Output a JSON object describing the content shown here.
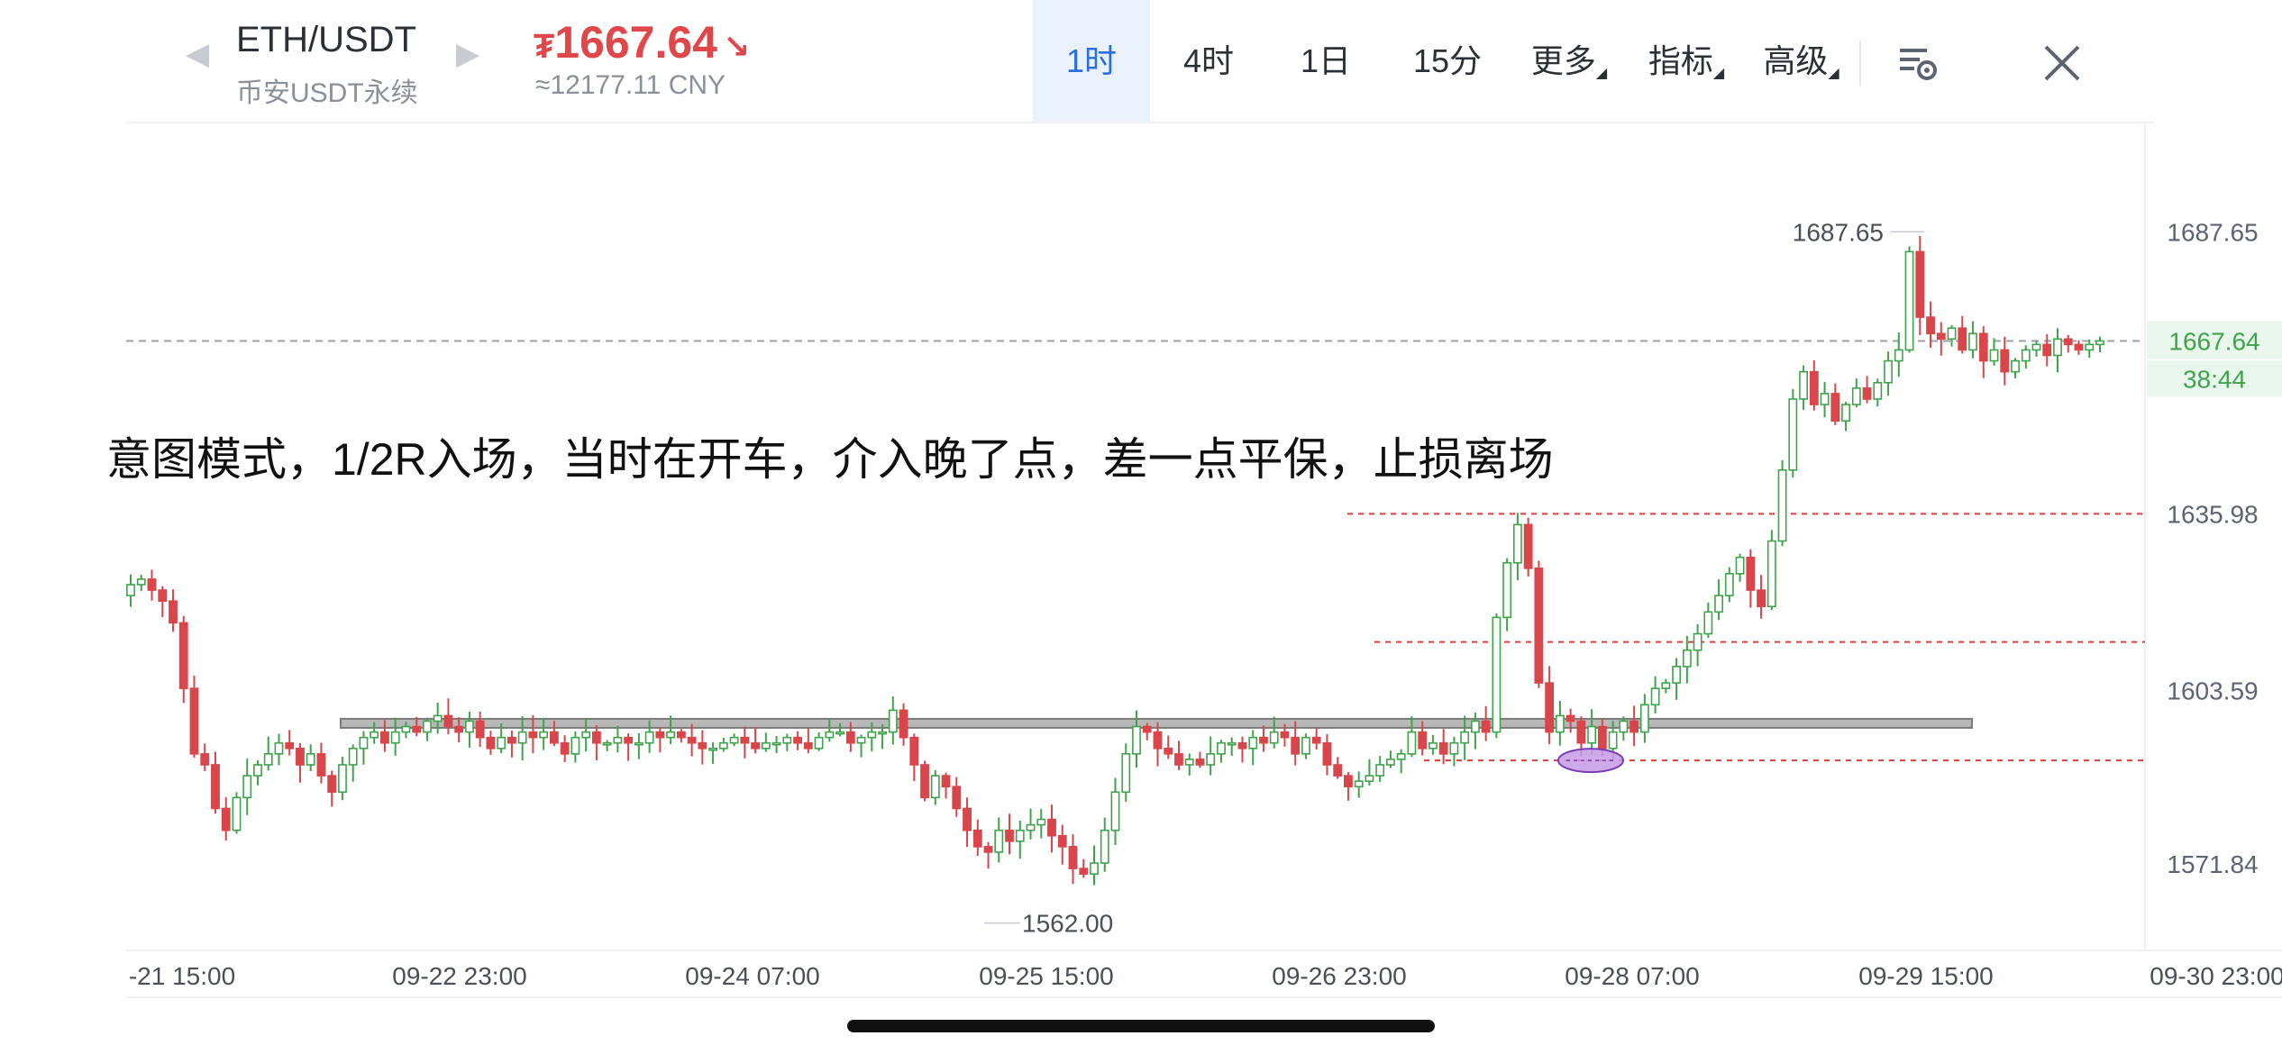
{
  "header": {
    "pair": "ETH/USDT",
    "market": "币安USDT永续",
    "price_currency": "₮",
    "price": "1667.64",
    "price_direction_glyph": "↘",
    "price_cny": "≈12177.11 CNY",
    "tabs": [
      {
        "label": "1时",
        "active": true
      },
      {
        "label": "4时",
        "active": false
      },
      {
        "label": "1日",
        "active": false
      },
      {
        "label": "15分",
        "active": false
      },
      {
        "label": "更多",
        "active": false,
        "dropdown": true
      },
      {
        "label": "指标",
        "active": false,
        "dropdown": true
      },
      {
        "label": "高级",
        "active": false,
        "dropdown": true
      }
    ],
    "icons": [
      "prev-arrow-icon",
      "next-arrow-icon",
      "chart-settings-icon",
      "close-icon"
    ]
  },
  "annotation": "意图模式，1/2R入场，当时在开车，介入晚了点，差一点平保，止损离场",
  "chart_data": {
    "type": "candlestick",
    "colors": {
      "up": "#3fa34d",
      "down": "#d8464b",
      "guide": "#e03a3a",
      "zone": "#a6a6a6",
      "marker": "#c79be8"
    },
    "y_ticks": [
      1687.65,
      1667.64,
      1635.98,
      1603.59,
      1571.84
    ],
    "y_tick_labels": [
      "1687.65",
      "1667.64",
      "1635.98",
      "1603.59",
      "1571.84"
    ],
    "ylim": [
      1556,
      1707
    ],
    "x_tick_labels": [
      "-21 15:00",
      "09-22 23:00",
      "09-24 07:00",
      "09-25 15:00",
      "09-26 23:00",
      "09-28 07:00",
      "09-29 15:00",
      "09-30 23:00"
    ],
    "current_price": {
      "value": 1667.64,
      "label": "1667.64",
      "countdown": "38:44"
    },
    "high_label": {
      "value": 1687.65,
      "label": "1687.65"
    },
    "low_label": {
      "value": 1562.0,
      "label": "1562.00"
    },
    "horizontal_lines": [
      {
        "name": "resistance",
        "value": 1635.98,
        "style": "dashed-red"
      },
      {
        "name": "mid-level",
        "value": 1612.5,
        "style": "dashed-red"
      },
      {
        "name": "stop-level",
        "value": 1590.8,
        "style": "dashed-red"
      }
    ],
    "range_zone": {
      "value": 1597.6
    },
    "marker": {
      "value": 1590.8
    },
    "candles_hourly_close": [
      1623,
      1624,
      1622,
      1620,
      1616,
      1604,
      1592,
      1590,
      1582,
      1578,
      1584,
      1588,
      1590,
      1592,
      1594,
      1593,
      1590,
      1592,
      1588,
      1585,
      1590,
      1593,
      1595,
      1596,
      1594,
      1596,
      1597,
      1596,
      1598,
      1599,
      1597,
      1596,
      1598,
      1595,
      1593,
      1595,
      1594,
      1596,
      1595,
      1596,
      1594,
      1592,
      1595,
      1596,
      1594,
      1594,
      1595,
      1594,
      1594,
      1596,
      1595,
      1596,
      1595,
      1594,
      1593,
      1593,
      1594,
      1595,
      1594,
      1593,
      1594,
      1594,
      1595,
      1594,
      1593,
      1595,
      1596,
      1596,
      1594,
      1595,
      1596,
      1596,
      1600,
      1595,
      1590,
      1584,
      1588,
      1586,
      1582,
      1578,
      1575,
      1574,
      1578,
      1576,
      1578,
      1579,
      1580,
      1577,
      1575,
      1571,
      1570,
      1572,
      1578,
      1585,
      1592,
      1597,
      1596,
      1593,
      1592,
      1590,
      1591,
      1590,
      1592,
      1594,
      1594,
      1593,
      1595,
      1594,
      1596,
      1595,
      1592,
      1595,
      1594,
      1590,
      1588,
      1586,
      1587,
      1588,
      1590,
      1591,
      1592,
      1596,
      1593,
      1594,
      1592,
      1594,
      1596,
      1598,
      1596,
      1617,
      1627,
      1634,
      1626,
      1605,
      1596,
      1599,
      1598,
      1594,
      1597,
      1593,
      1596,
      1598,
      1596,
      1601,
      1604,
      1605,
      1608,
      1611,
      1614,
      1618,
      1621,
      1625,
      1628,
      1622,
      1619,
      1631,
      1644,
      1657,
      1662,
      1656,
      1658,
      1653,
      1656,
      1659,
      1657,
      1660,
      1664,
      1666,
      1684,
      1672,
      1669,
      1668,
      1670,
      1666,
      1669,
      1664,
      1666,
      1662,
      1664,
      1666,
      1667,
      1665,
      1668,
      1667,
      1666,
      1667,
      1667.64
    ]
  }
}
